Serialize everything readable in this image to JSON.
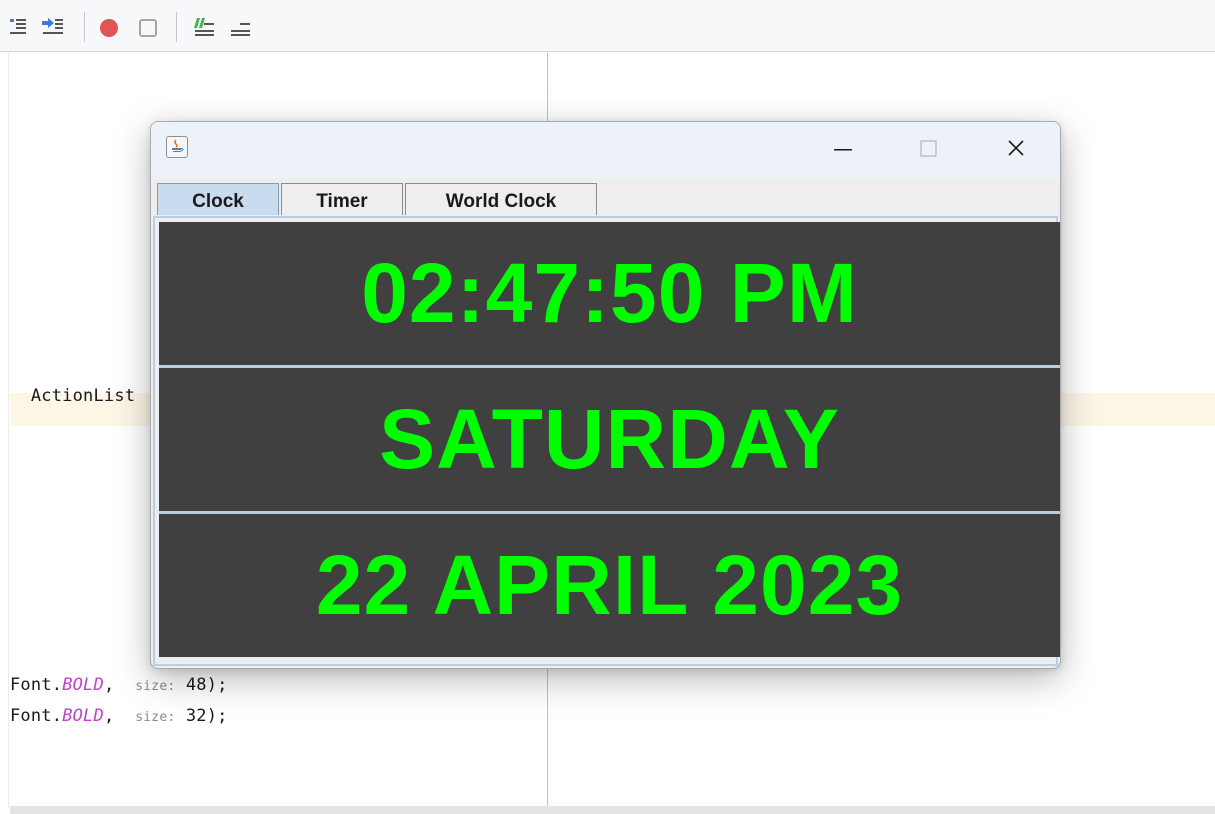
{
  "ide": {
    "code_lines": {
      "line1": "ActionList",
      "line2_prefix": "Font.",
      "line2_kw": "BOLD",
      "line2_sep": ",  ",
      "line2_hint": "size:",
      "line2_value": " 48);",
      "line3_prefix": "Font.",
      "line3_kw": "BOLD",
      "line3_sep": ",  ",
      "line3_hint": "size:",
      "line3_value": " 32);"
    },
    "toolbar_icons": [
      "step-into-icon",
      "step-out-icon",
      "record-icon",
      "stop-icon",
      "run-to-cursor-icon",
      "evaluate-icon"
    ]
  },
  "window": {
    "tabs": [
      {
        "label": "Clock",
        "active": true
      },
      {
        "label": "Timer",
        "active": false
      },
      {
        "label": "World Clock",
        "active": false
      }
    ],
    "clock": {
      "time": "02:47:50 PM",
      "day": "SATURDAY",
      "date": "22 APRIL 2023"
    }
  },
  "colors": {
    "panel_bg": "#404040",
    "clock_text": "#00ff00",
    "active_tab": "#c9dcef"
  }
}
